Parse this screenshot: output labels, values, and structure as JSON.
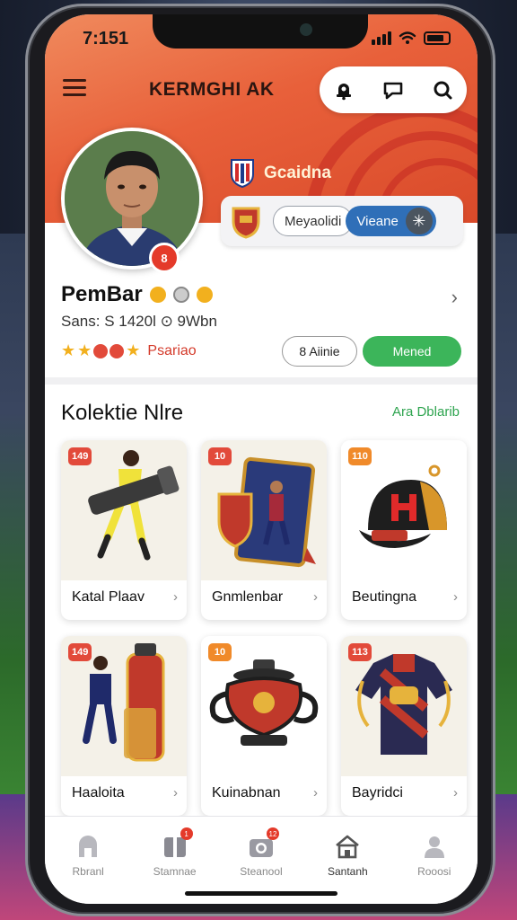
{
  "status": {
    "time": "7:151"
  },
  "header": {
    "title": "KERMGHI AK"
  },
  "profile": {
    "club_name": "Gcaidna",
    "toggle_left": "Meyaolidi",
    "toggle_right": "Vieane",
    "badge": "8",
    "name": "PemBar",
    "stats": "Sans: S 1420l ⊙ 9Wbn",
    "rank_text": "Psariao",
    "follow_label": "8 Aiinie",
    "message_label": "Mened"
  },
  "collection": {
    "title": "Kolektie Nlre",
    "see_all": "Ara Dblarib",
    "items": [
      {
        "badge": "149",
        "badge_color": "#e24a3a",
        "label": "Katal Plaav"
      },
      {
        "badge": "10",
        "badge_color": "#e24a3a",
        "label": "Gnmlenbar"
      },
      {
        "badge": "110",
        "badge_color": "#f08a2a",
        "label": "Beutingna"
      },
      {
        "badge": "149",
        "badge_color": "#e24a3a",
        "label": "Haaloita"
      },
      {
        "badge": "10",
        "badge_color": "#f08a2a",
        "label": "Kuinabnan"
      },
      {
        "badge": "113",
        "badge_color": "#e24a3a",
        "label": "Bayridci"
      }
    ]
  },
  "tabs": [
    {
      "label": "Rbranl",
      "icon": "home-icon",
      "dot": ""
    },
    {
      "label": "Stamnae",
      "icon": "collection-icon",
      "dot": "1"
    },
    {
      "label": "Steanool",
      "icon": "camera-icon",
      "dot": "12"
    },
    {
      "label": "Santanh",
      "icon": "shop-icon",
      "dot": ""
    },
    {
      "label": "Rooosi",
      "icon": "profile-icon",
      "dot": ""
    }
  ],
  "colors": {
    "accent": "#e8603a",
    "green": "#3cb55a",
    "blue": "#2f6fb8"
  }
}
